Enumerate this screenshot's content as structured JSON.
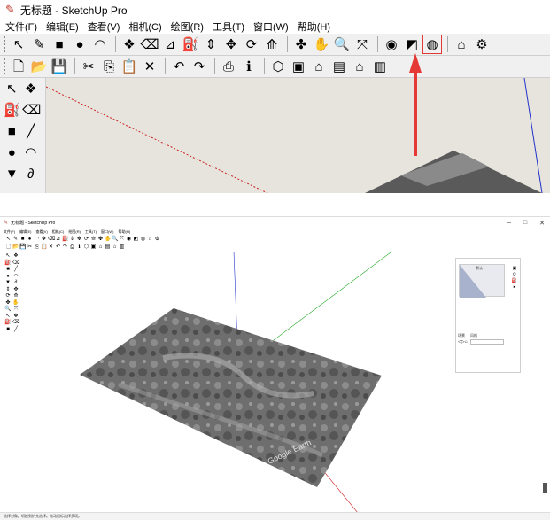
{
  "window": {
    "icon": "sketchup-icon",
    "title": "无标题 - SketchUp Pro",
    "controls": [
      "–",
      "□",
      "✕"
    ]
  },
  "menu": [
    "文件(F)",
    "编辑(E)",
    "查看(V)",
    "相机(C)",
    "绘图(R)",
    "工具(T)",
    "窗口(W)",
    "帮助(H)"
  ],
  "toolbar_row1": [
    {
      "name": "select-icon",
      "glyph": "↖"
    },
    {
      "name": "pencil-icon",
      "glyph": "✎"
    },
    {
      "name": "rectangle-icon",
      "glyph": "■"
    },
    {
      "name": "circle-icon",
      "glyph": "●"
    },
    {
      "name": "arc-icon",
      "glyph": "◠"
    },
    {
      "name": "make-component-icon",
      "glyph": "❖"
    },
    {
      "name": "eraser-icon",
      "glyph": "⌫"
    },
    {
      "name": "tape-measure-icon",
      "glyph": "⊿"
    },
    {
      "name": "paint-bucket-icon",
      "glyph": "⛽"
    },
    {
      "name": "push-pull-icon",
      "glyph": "⇕"
    },
    {
      "name": "move-icon",
      "glyph": "✥"
    },
    {
      "name": "rotate-icon",
      "glyph": "⟳"
    },
    {
      "name": "offset-icon",
      "glyph": "⟰"
    },
    {
      "name": "orbit-icon",
      "glyph": "✤"
    },
    {
      "name": "pan-icon",
      "glyph": "✋"
    },
    {
      "name": "zoom-icon",
      "glyph": "🔍"
    },
    {
      "name": "zoom-extents-icon",
      "glyph": "⤧"
    },
    {
      "name": "add-location-icon",
      "glyph": "◉"
    },
    {
      "name": "toggle-terrain-icon",
      "glyph": "◩"
    },
    {
      "name": "photo-textures-icon",
      "glyph": "◍"
    },
    {
      "name": "warehouse-icon",
      "glyph": "⌂"
    },
    {
      "name": "extension-warehouse-icon",
      "glyph": "⚙"
    }
  ],
  "toolbar_row2": [
    {
      "name": "new-icon",
      "glyph": "🗋"
    },
    {
      "name": "open-icon",
      "glyph": "📂"
    },
    {
      "name": "save-icon",
      "glyph": "💾"
    },
    {
      "name": "cut-icon",
      "glyph": "✂"
    },
    {
      "name": "copy-icon",
      "glyph": "⎘"
    },
    {
      "name": "paste-icon",
      "glyph": "📋"
    },
    {
      "name": "delete-icon",
      "glyph": "✕"
    },
    {
      "name": "undo-icon",
      "glyph": "↶"
    },
    {
      "name": "redo-icon",
      "glyph": "↷"
    },
    {
      "name": "print-icon",
      "glyph": "⎙"
    },
    {
      "name": "model-info-icon",
      "glyph": "ℹ"
    },
    {
      "name": "iso-view-icon",
      "glyph": "⬡"
    },
    {
      "name": "top-view-icon",
      "glyph": "▣"
    },
    {
      "name": "front-view-icon",
      "glyph": "⌂"
    },
    {
      "name": "right-view-icon",
      "glyph": "▤"
    },
    {
      "name": "back-view-icon",
      "glyph": "⌂"
    },
    {
      "name": "left-view-icon",
      "glyph": "▥"
    }
  ],
  "left_tools": [
    {
      "name": "select-icon",
      "glyph": "↖"
    },
    {
      "name": "make-component-icon",
      "glyph": "❖"
    },
    {
      "name": "paint-bucket-icon",
      "glyph": "⛽"
    },
    {
      "name": "eraser-icon",
      "glyph": "⌫"
    },
    {
      "name": "rectangle-icon",
      "glyph": "■"
    },
    {
      "name": "line-icon",
      "glyph": "╱"
    },
    {
      "name": "circle-icon",
      "glyph": "●"
    },
    {
      "name": "arc-icon",
      "glyph": "◠"
    },
    {
      "name": "polygon-icon",
      "glyph": "▼"
    },
    {
      "name": "freehand-icon",
      "glyph": "∂"
    }
  ],
  "highlight": {
    "target": "photo-textures-icon",
    "color": "#e53935"
  },
  "colors": {
    "axis_red": "#cc2222",
    "axis_green": "#22aa22",
    "axis_blue": "#2233cc",
    "canvas_bg": "#e6e4dc"
  },
  "tray": {
    "preview_label": "默认",
    "tabs": [
      "场景",
      "风格"
    ]
  },
  "terrain": {
    "watermark": "Google Earth"
  },
  "statusbar": {
    "text": "选择对象。切换到扩充选择。拖动鼠标选择多项。"
  }
}
